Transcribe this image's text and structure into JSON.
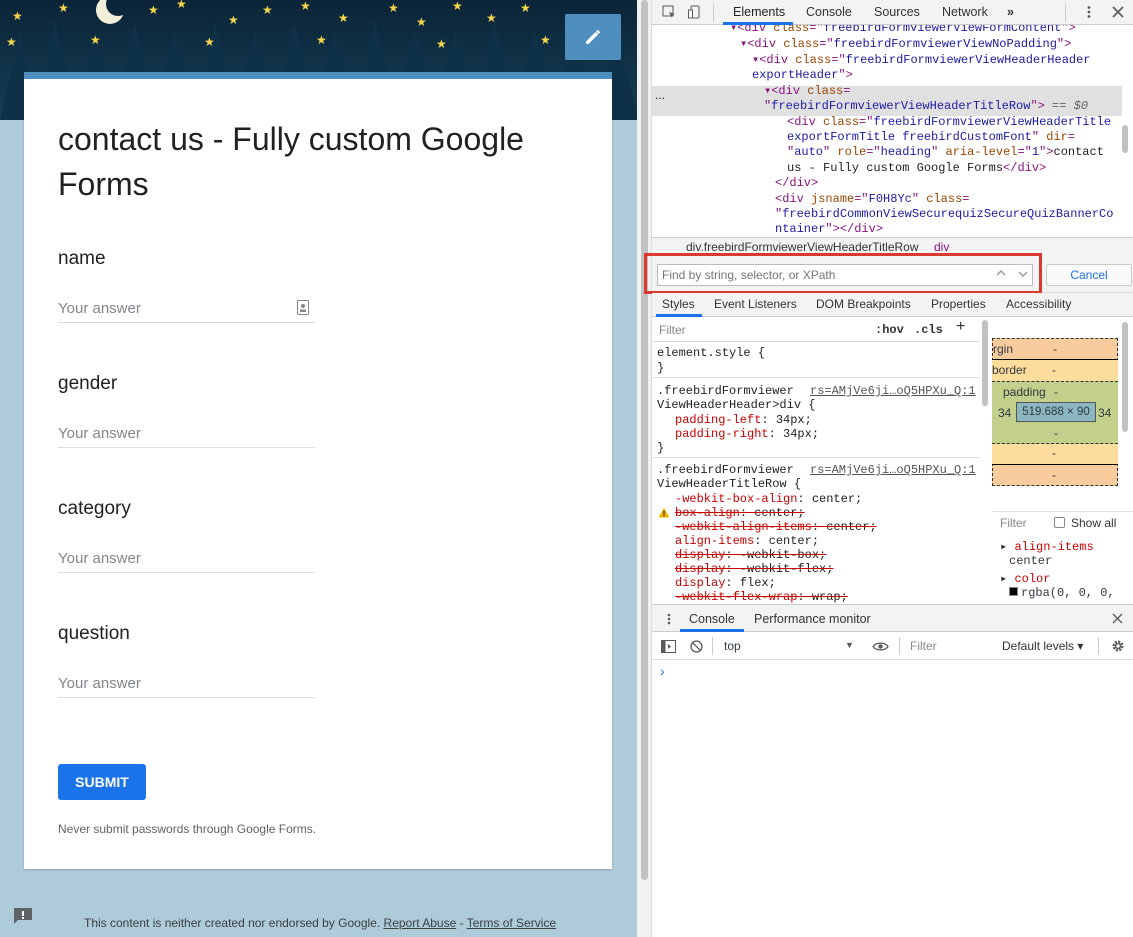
{
  "form": {
    "title": "contact us - Fully custom Google Forms",
    "questions": [
      {
        "label": "name",
        "placeholder": "Your answer"
      },
      {
        "label": "gender",
        "placeholder": "Your answer"
      },
      {
        "label": "category",
        "placeholder": "Your answer"
      },
      {
        "label": "question",
        "placeholder": "Your answer"
      }
    ],
    "submit_label": "SUBMIT",
    "password_warning": "Never submit passwords through Google Forms.",
    "footer": {
      "text": "This content is neither created nor endorsed by Google.",
      "report_abuse": "Report Abuse",
      "separator": " - ",
      "terms": "Terms of Service"
    }
  },
  "devtools": {
    "tabs": [
      "Elements",
      "Console",
      "Sources",
      "Network"
    ],
    "active_tab": "Elements",
    "more_tabs": "»",
    "breadcrumb": {
      "item1": "div.freebirdFormviewerViewHeaderTitleRow",
      "item2": "div"
    },
    "dom": {
      "l1": [
        "<div ",
        "class",
        "=\"",
        "freebirdFormviewerViewFormContent",
        "\">"
      ],
      "l2": [
        "<div ",
        "class",
        "=\"",
        "freebirdFormviewerViewNoPadding",
        "\">"
      ],
      "l3": [
        "<div ",
        "class",
        "=\"",
        "freebirdFormviewerViewHeaderHeader"
      ],
      "l3b": [
        "exportHeader",
        "\">"
      ],
      "l4": [
        "<div ",
        "class",
        "="
      ],
      "l4b": [
        "\"",
        "freebirdFormviewerViewHeaderTitleRow",
        "\">",
        " == $0"
      ],
      "l5": [
        "<div ",
        "class",
        "=\"",
        "freebirdFormviewerViewHeaderTitle"
      ],
      "l5b": [
        "exportFormTitle freebirdCustomFont",
        "\" ",
        "dir",
        "="
      ],
      "l5c": [
        "\"",
        "auto",
        "\" ",
        "role",
        "=\"",
        "heading",
        "\" ",
        "aria-level",
        "=\"",
        "1",
        "\">",
        "contact"
      ],
      "l5d": [
        "us - Fully custom Google Forms",
        "</div>"
      ],
      "l6": [
        "</div>"
      ],
      "l7": [
        "<div ",
        "jsname",
        "=\"",
        "F0H8Yc",
        "\" ",
        "class",
        "="
      ],
      "l7b": [
        "\"",
        "freebirdCommonViewSecurequizSecureQuizBannerCo"
      ],
      "l7c": [
        "ntainer",
        "\">",
        "</div>"
      ],
      "ellipsis": "..."
    },
    "search": {
      "placeholder": "Find by string, selector, or XPath",
      "cancel": "Cancel"
    },
    "sub_tabs": [
      "Styles",
      "Event Listeners",
      "DOM Breakpoints",
      "Properties",
      "Accessibility"
    ],
    "styles": {
      "filter_placeholder": "Filter",
      "hov": ":hov",
      "cls": ".cls",
      "plus": "+",
      "element_style": "element.style {",
      "close_brace": "}",
      "rule1_sel1": ".freebirdFormviewer",
      "rule1_sel2": "ViewHeaderHeader>div {",
      "rule1_src": "rs=AMjVe6ji…oQ5HPXu_Q:1",
      "rule1_p1": [
        "padding-left",
        ": 34px;"
      ],
      "rule1_p2": [
        "padding-right",
        ": 34px;"
      ],
      "rule2_sel1": ".freebirdFormviewer",
      "rule2_sel2": "ViewHeaderTitleRow {",
      "rule2_src": "rs=AMjVe6ji…oQ5HPXu_Q:1",
      "rule2_props": [
        {
          "name": "-webkit-box-align",
          "value": ": center;",
          "struck": false
        },
        {
          "name": "box-align",
          "value": ": center;",
          "struck": true
        },
        {
          "name": "-webkit-align-items",
          "value": ": center;",
          "struck": true
        },
        {
          "name": "align-items",
          "value": ": center;",
          "struck": false
        },
        {
          "name": "display",
          "value": ": -webkit-box;",
          "struck": true
        },
        {
          "name": "display",
          "value": ": -webkit-flex;",
          "struck": true
        },
        {
          "name": "display",
          "value": ": flex;",
          "struck": false
        },
        {
          "name": "-webkit-flex-wrap",
          "value": ": wrap;",
          "struck": true
        }
      ]
    },
    "box_model": {
      "margin": "rgin",
      "border": "border",
      "padding": "padding",
      "dash": "-",
      "left": "34",
      "right": "34",
      "content": "519.688 × 90"
    },
    "computed": {
      "filter": "Filter",
      "show_all": "Show all",
      "p1_name": "align-items",
      "p1_value": "center",
      "p2_name": "color",
      "p2_value": "rgba(0, 0, 0,"
    },
    "console": {
      "tabs": [
        "Console",
        "Performance monitor"
      ],
      "context": "top",
      "filter_placeholder": "Filter",
      "levels": "Default levels ▾",
      "prompt": "›"
    }
  },
  "colors": {
    "accent": "#1a73e8",
    "header_blue": "#4f8fc0",
    "search_highlight": "#d93a30"
  }
}
